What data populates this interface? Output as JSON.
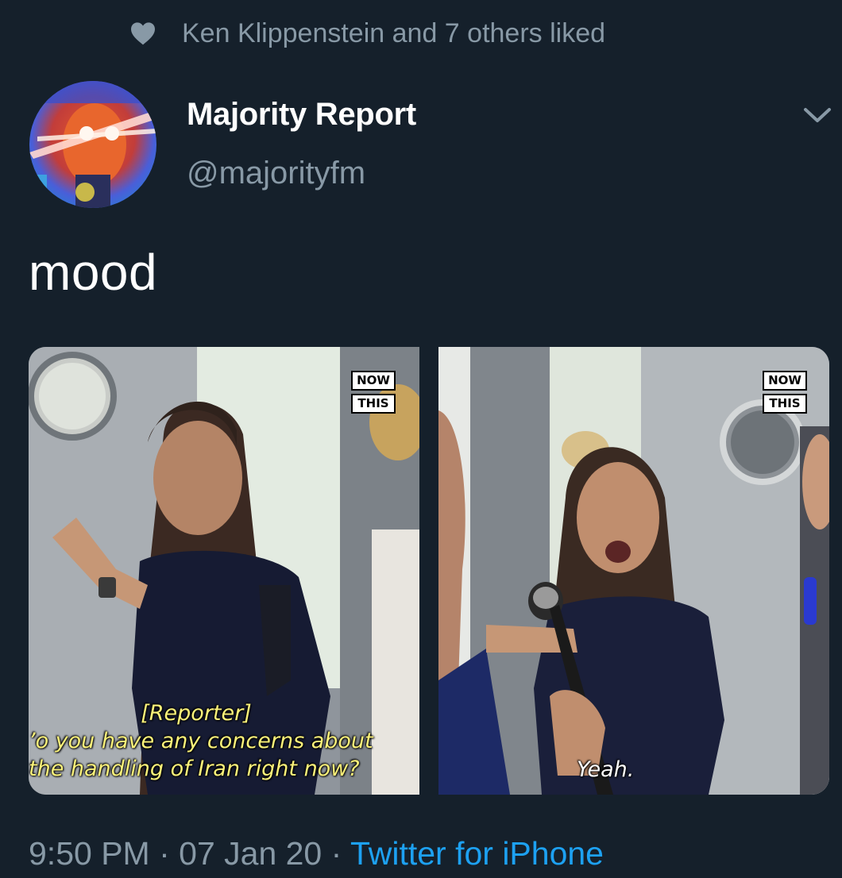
{
  "social_context": {
    "text": "Ken Klippenstein and 7 others liked"
  },
  "author": {
    "display_name": "Majority Report",
    "handle": "@majorityfm"
  },
  "tweet": {
    "text": "mood"
  },
  "media": [
    {
      "logo_line1": "NOW",
      "logo_line2": "THIS",
      "subtitle_lines": [
        "[Reporter]",
        "’o you have any concerns about",
        "the handling of Iran right now?"
      ]
    },
    {
      "logo_line1": "NOW",
      "logo_line2": "THIS",
      "subtitle_lines": [
        "Yeah."
      ]
    }
  ],
  "footer": {
    "time": "9:50 PM",
    "separator": " · ",
    "date": "07 Jan 20",
    "source": "Twitter for iPhone"
  },
  "colors": {
    "background": "#15202b",
    "secondary_text": "#8899a6",
    "link": "#1da1f2",
    "subtitle_yellow": "#fbf27a"
  },
  "icons": {
    "liked": "heart-icon",
    "menu": "chevron-down-icon"
  }
}
